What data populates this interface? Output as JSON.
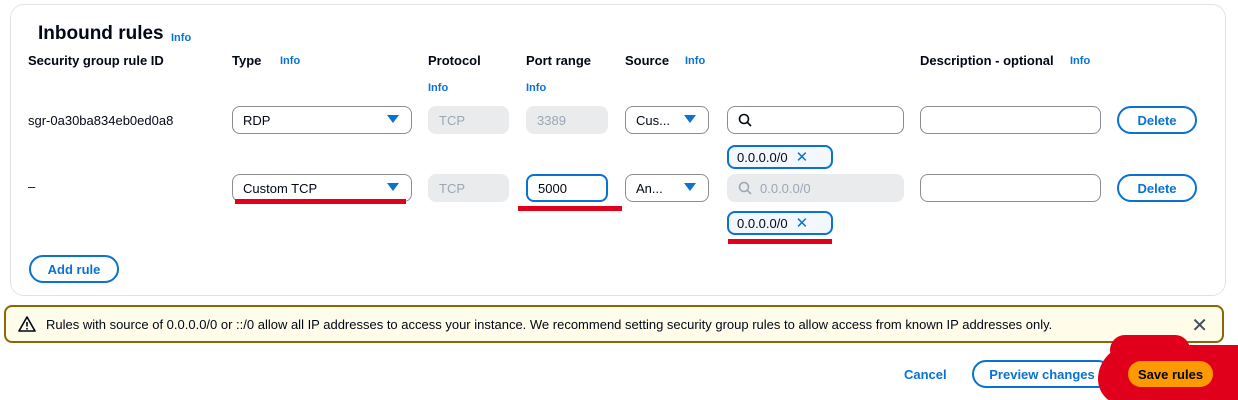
{
  "section": {
    "title": "Inbound rules",
    "title_info": "Info"
  },
  "columns": {
    "rule_id": "Security group rule ID",
    "type": "Type",
    "type_info": "Info",
    "protocol": "Protocol",
    "protocol_info": "Info",
    "port_range": "Port range",
    "port_range_info": "Info",
    "source": "Source",
    "source_info": "Info",
    "description": "Description - optional",
    "description_info": "Info"
  },
  "rules": [
    {
      "id": "sgr-0a30ba834eb0ed0a8",
      "type": "RDP",
      "protocol": "TCP",
      "port": "3389",
      "source_type": "Cus...",
      "source_search": "",
      "source_placeholder": "",
      "cidr": "0.0.0.0/0",
      "description": "",
      "delete_label": "Delete"
    },
    {
      "id": "–",
      "type": "Custom TCP",
      "protocol": "TCP",
      "port": "5000",
      "source_type": "An...",
      "source_search": "",
      "source_placeholder": "0.0.0.0/0",
      "cidr": "0.0.0.0/0",
      "description": "",
      "delete_label": "Delete"
    }
  ],
  "add_rule_label": "Add rule",
  "warning": {
    "text": "Rules with source of 0.0.0.0/0 or ::/0 allow all IP addresses to access your instance. We recommend setting security group rules to allow access from known IP addresses only.",
    "close": "✕"
  },
  "footer": {
    "cancel": "Cancel",
    "preview": "Preview changes",
    "save": "Save rules"
  },
  "colors": {
    "accent": "#0972d3",
    "annotation_red": "#e0001b",
    "save_button": "#ff9900"
  }
}
